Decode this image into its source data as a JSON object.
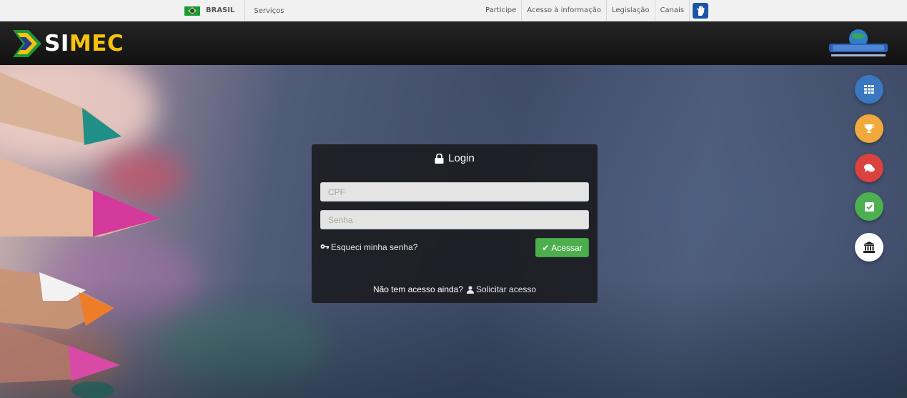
{
  "gov_bar": {
    "country": "BRASIL",
    "services": "Serviços",
    "links": [
      "Participe",
      "Acesso à informação",
      "Legislação",
      "Canais"
    ]
  },
  "header": {
    "logo_si": "SI",
    "logo_mec": "MEC",
    "brand_colors": {
      "yellow": "#f6c20e",
      "green": "#1b9a3a",
      "blue": "#2a3b8f"
    }
  },
  "login": {
    "title": "Login",
    "cpf_placeholder": "CPF",
    "password_placeholder": "Senha",
    "forgot_link": "Esqueci minha senha?",
    "submit_label": "Acessar",
    "no_access_text": "Não tem acesso ainda?",
    "request_access_link": "Solicitar acesso"
  },
  "shortcuts": [
    {
      "icon": "grid-icon",
      "color": "#3a77c1"
    },
    {
      "icon": "trophy-icon",
      "color": "#f0a93a"
    },
    {
      "icon": "chat-icon",
      "color": "#d9423e"
    },
    {
      "icon": "checkbox-icon",
      "color": "#4caf50"
    },
    {
      "icon": "institution-icon",
      "color": "#ffffff"
    }
  ]
}
